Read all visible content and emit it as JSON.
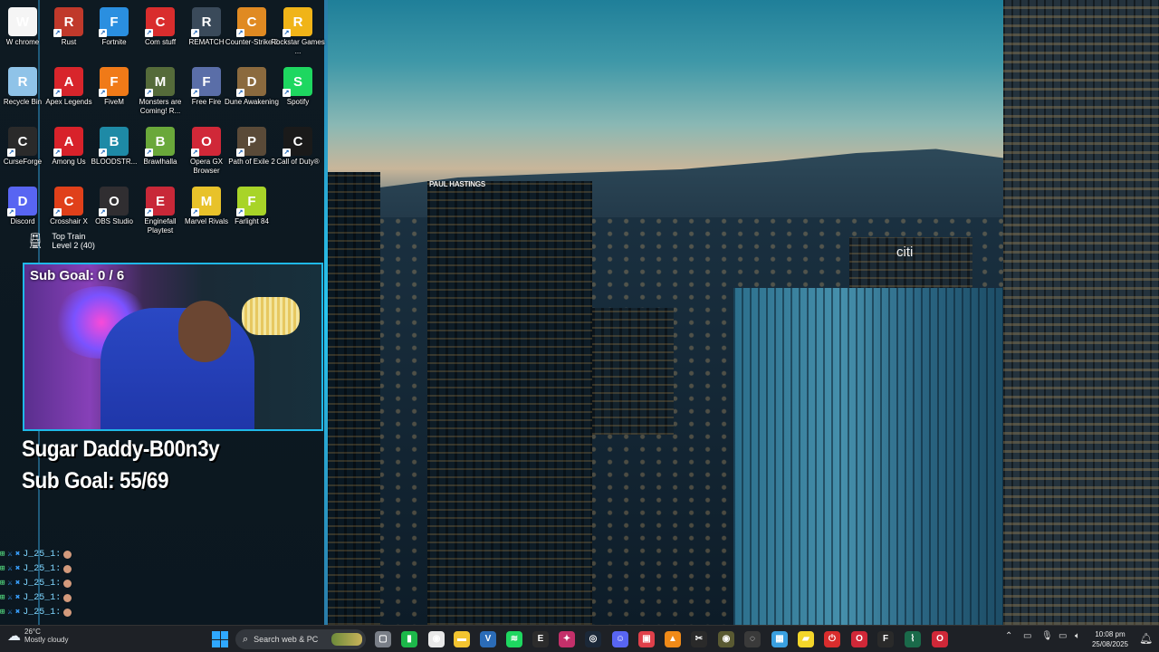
{
  "wallpaper": {
    "sign_paul_hastings": "PAUL HASTINGS",
    "sign_citi": "citi"
  },
  "desktop_icons": [
    {
      "label": "W chrome",
      "icon": "chrome-icon",
      "color": "#f5f5f5"
    },
    {
      "label": "Rust",
      "icon": "rust-icon",
      "color": "#c0392b"
    },
    {
      "label": "Fortnite",
      "icon": "fortnite-icon",
      "color": "#2a8fe0"
    },
    {
      "label": "Com stuff",
      "icon": "power-icon",
      "color": "#d92d2d"
    },
    {
      "label": "REMATCH",
      "icon": "rematch-icon",
      "color": "#3a4a5a"
    },
    {
      "label": "Counter-Strike 2",
      "icon": "counter-strike-icon",
      "color": "#e08a22"
    },
    {
      "label": "Rockstar Games ...",
      "icon": "rockstar-icon",
      "color": "#f0b418"
    },
    {
      "label": "Recycle Bin",
      "icon": "recycle-bin-icon",
      "color": "#8fc3e8"
    },
    {
      "label": "Apex Legends",
      "icon": "apex-legends-icon",
      "color": "#d8252b"
    },
    {
      "label": "FiveM",
      "icon": "fivem-icon",
      "color": "#f07a18"
    },
    {
      "label": "Monsters are Coming! R...",
      "icon": "monsters-icon",
      "color": "#556b3a"
    },
    {
      "label": "Free Fire",
      "icon": "free-fire-icon",
      "color": "#5a6ea8"
    },
    {
      "label": "Dune Awakening",
      "icon": "dune-icon",
      "color": "#8b6a3e"
    },
    {
      "label": "Spotify",
      "icon": "spotify-icon",
      "color": "#1ed760"
    },
    {
      "label": "CurseForge",
      "icon": "curseforge-icon",
      "color": "#2a2a2a"
    },
    {
      "label": "Among Us",
      "icon": "among-us-icon",
      "color": "#d8222a"
    },
    {
      "label": "BLOODSTR...",
      "icon": "bloodstrike-icon",
      "color": "#1e8aa6"
    },
    {
      "label": "Brawlhalla",
      "icon": "brawlhalla-icon",
      "color": "#6aa83a"
    },
    {
      "label": "Opera GX Browser",
      "icon": "opera-gx-icon",
      "color": "#d02838"
    },
    {
      "label": "Path of Exile 2",
      "icon": "path-of-exile-icon",
      "color": "#5a4a38"
    },
    {
      "label": "Call of Duty®",
      "icon": "call-of-duty-icon",
      "color": "#1a1a1a"
    },
    {
      "label": "Discord",
      "icon": "discord-icon",
      "color": "#5865f2"
    },
    {
      "label": "Crosshair X",
      "icon": "crosshair-icon",
      "color": "#e0401a"
    },
    {
      "label": "OBS Studio",
      "icon": "obs-icon",
      "color": "#302e31"
    },
    {
      "label": "Enginefall Playtest",
      "icon": "enginefall-icon",
      "color": "#c82838"
    },
    {
      "label": "Marvel Rivals",
      "icon": "marvel-rivals-icon",
      "color": "#e8c22a"
    },
    {
      "label": "Farlight 84",
      "icon": "farlight-icon",
      "color": "#a8d428"
    }
  ],
  "stream_overlay": {
    "train_title": "Top Train",
    "train_level": "Level 2  (40)",
    "webcam_goal": "Sub Goal:  0 / 6",
    "name_text": "Sugar Daddy-B00n3y",
    "sub_goal_text": "Sub Goal: 55/69"
  },
  "chat_feed": [
    {
      "user": "J_25_1:"
    },
    {
      "user": "J_25_1:"
    },
    {
      "user": "J_25_1:"
    },
    {
      "user": "J_25_1:"
    },
    {
      "user": "J_25_1:"
    }
  ],
  "taskbar": {
    "weather_temp": "26°C",
    "weather_condition": "Mostly cloudy",
    "search_placeholder": "Search web & PC",
    "apps": [
      {
        "icon": "task-view-icon",
        "color": "#7a7f88",
        "glyph": "▢"
      },
      {
        "icon": "xbox-game-bar-icon",
        "color": "#1db84a",
        "glyph": "▮"
      },
      {
        "icon": "chrome-icon",
        "color": "#e8e8e8",
        "glyph": "◉"
      },
      {
        "icon": "file-explorer-icon",
        "color": "#f3c430",
        "glyph": "▬"
      },
      {
        "icon": "visual-studio-icon",
        "color": "#2b6cb8",
        "glyph": "V"
      },
      {
        "icon": "spotify-icon",
        "color": "#1ed760",
        "glyph": "≋"
      },
      {
        "icon": "epic-games-icon",
        "color": "#2c2c2c",
        "glyph": "E"
      },
      {
        "icon": "gear-app-icon",
        "color": "#c4306a",
        "glyph": "✦"
      },
      {
        "icon": "steam-icon",
        "color": "#1b2838",
        "glyph": "◎"
      },
      {
        "icon": "discord-icon",
        "color": "#5865f2",
        "glyph": "☺"
      },
      {
        "icon": "media-app-icon",
        "color": "#e0404a",
        "glyph": "▣"
      },
      {
        "icon": "vlc-icon",
        "color": "#f08a18",
        "glyph": "▲"
      },
      {
        "icon": "capcut-icon",
        "color": "#2a2a2a",
        "glyph": "✂"
      },
      {
        "icon": "eye-app-icon",
        "color": "#5a5a32",
        "glyph": "◉"
      },
      {
        "icon": "notification-app-icon",
        "color": "#3a3a3a",
        "glyph": "◌"
      },
      {
        "icon": "photos-icon",
        "color": "#3aa0e0",
        "glyph": "▦"
      },
      {
        "icon": "sticky-notes-icon",
        "color": "#f4d62a",
        "glyph": "▰"
      },
      {
        "icon": "power-icon",
        "color": "#d92d2d",
        "glyph": "⏻"
      },
      {
        "icon": "opera-gx-icon",
        "color": "#d02838",
        "glyph": "O"
      },
      {
        "icon": "faceit-icon",
        "color": "#2a2a2a",
        "glyph": "F"
      },
      {
        "icon": "stocks-app-icon",
        "color": "#1a6a4a",
        "glyph": "⌇"
      },
      {
        "icon": "opera-gx-icon",
        "color": "#d02838",
        "glyph": "O"
      }
    ],
    "clock_time": "10:08 pm",
    "clock_date": "25/08/2025"
  }
}
